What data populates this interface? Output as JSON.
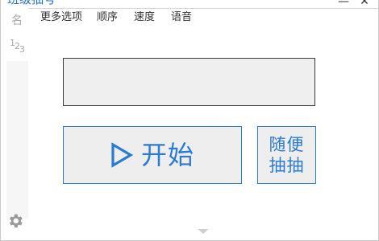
{
  "window": {
    "title": "班级抽号",
    "minimize_glyph": "—",
    "close_glyph": "✕"
  },
  "sidebar": {
    "name_glyph": "名",
    "number_glyph": [
      "1",
      "2",
      "3"
    ],
    "settings_icon": "gear-icon"
  },
  "menu": {
    "items": [
      {
        "label": "更多选项"
      },
      {
        "label": "顺序"
      },
      {
        "label": "速度"
      },
      {
        "label": "语音"
      }
    ]
  },
  "display": {
    "text": ""
  },
  "buttons": {
    "start_label": "开始",
    "start_icon": "play-icon",
    "random_line1": "随便",
    "random_line2": "抽抽"
  },
  "colors": {
    "accent": "#2b7bd2",
    "button_bg": "#eeeeee",
    "display_bg": "#efefef",
    "icon_gray": "#a9a9a9"
  }
}
